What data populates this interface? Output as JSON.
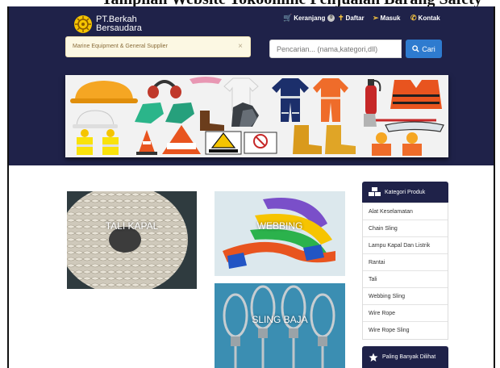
{
  "page_heading": "Tampilan Website Tokoonline Penjualan Barang Safety",
  "brand": {
    "line1": "PT.Berkah",
    "line2": "Bersaudara"
  },
  "nav": {
    "cart": "Keranjang",
    "cart_count": "0",
    "register": "Daftar",
    "login": "Masuk",
    "contact": "Kontak"
  },
  "alert": {
    "text": "Marine Equipment & General Supplier",
    "close": "×"
  },
  "search": {
    "placeholder": "Pencarian... (nama,kategori,dll)",
    "button": "Cari"
  },
  "products": [
    {
      "label": "TALI KAPAL"
    },
    {
      "label": "WEBBING"
    },
    {
      "label": "SLING BAJA"
    }
  ],
  "sidebar": {
    "category_title": "Kategori Produk",
    "categories": [
      "Alat Keselamatan",
      "Chain Sling",
      "Lampu Kapal Dan Listrik",
      "Rantai",
      "Tali",
      "Webbing Sling",
      "Wire Rope",
      "Wire Rope Sling"
    ],
    "popular_title": "Paling Banyak Dilihat"
  },
  "colors": {
    "header_bg": "#1f2249",
    "search_button": "#2e7bcf",
    "alert_bg": "#fcf8e3",
    "sign_yellow": "#f5c400"
  }
}
